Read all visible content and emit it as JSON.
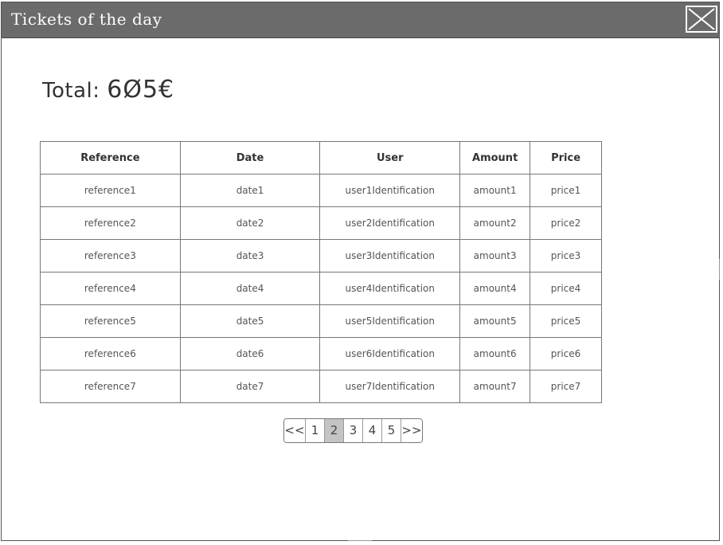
{
  "window": {
    "title": "Tickets of the day"
  },
  "summary": {
    "label": "Total:",
    "value": "6Ø5€"
  },
  "table": {
    "headers": [
      "Reference",
      "Date",
      "User",
      "Amount",
      "Price"
    ],
    "rows": [
      [
        "reference1",
        "date1",
        "user1Identification",
        "amount1",
        "price1"
      ],
      [
        "reference2",
        "date2",
        "user2Identification",
        "amount2",
        "price2"
      ],
      [
        "reference3",
        "date3",
        "user3Identification",
        "amount3",
        "price3"
      ],
      [
        "reference4",
        "date4",
        "user4Identification",
        "amount4",
        "price4"
      ],
      [
        "reference5",
        "date5",
        "user5Identification",
        "amount5",
        "price5"
      ],
      [
        "reference6",
        "date6",
        "user6Identification",
        "amount6",
        "price6"
      ],
      [
        "reference7",
        "date7",
        "user7Identification",
        "amount7",
        "price7"
      ]
    ]
  },
  "pagination": {
    "prev_label": "<<",
    "next_label": ">>",
    "pages": [
      "1",
      "2",
      "3",
      "4",
      "5"
    ],
    "current_page": "2"
  },
  "icons": {
    "close": "close-icon"
  }
}
